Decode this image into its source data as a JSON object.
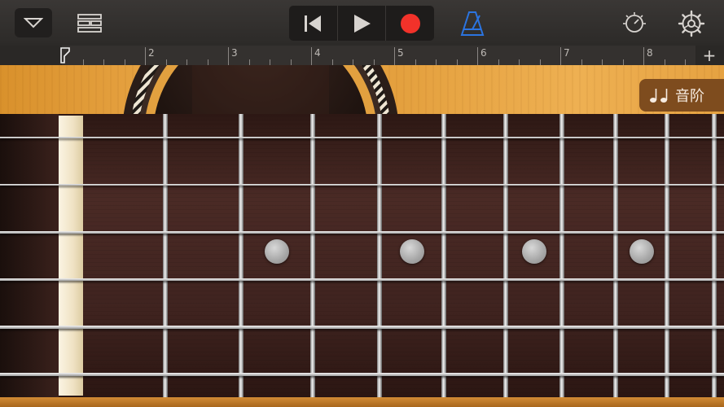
{
  "toolbar": {
    "view_icon": "chevron-down-icon",
    "tracks_icon": "tracks-view-icon",
    "rewind_icon": "skip-to-start-icon",
    "play_icon": "play-icon",
    "record_icon": "record-icon",
    "metronome_icon": "metronome-icon",
    "tune_icon": "track-controls-icon",
    "settings_icon": "gear-icon"
  },
  "ruler": {
    "bars": [
      "2",
      "3",
      "4",
      "5",
      "6",
      "7",
      "8"
    ],
    "add_label": "+"
  },
  "scales_button": {
    "label": "音阶",
    "icon": "music-note-icon"
  },
  "fretboard": {
    "string_count": 6,
    "fret_count": 10,
    "inlay_frets": [
      3,
      5,
      7,
      9
    ]
  },
  "colors": {
    "record": "#f2322a",
    "metronome": "#2b74e0",
    "body_wood": "#e6a241",
    "fretboard_wood": "#3f231f"
  }
}
